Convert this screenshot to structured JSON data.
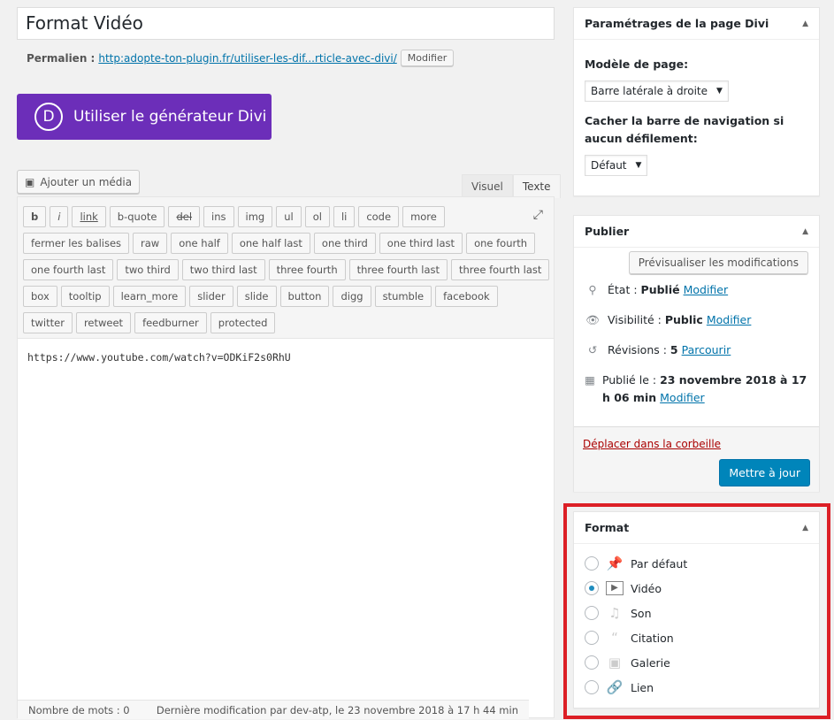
{
  "title": "Format Vidéo",
  "permalink": {
    "label": "Permalien :",
    "url": "http:adopte-ton-plugin.fr/utiliser-les-dif...rticle-avec-divi/",
    "edit": "Modifier"
  },
  "divi_button": {
    "icon": "D",
    "label": "Utiliser le générateur Divi",
    "color": "#6c2eb9"
  },
  "media_button": "Ajouter un média",
  "tabs": [
    "Visuel",
    "Texte"
  ],
  "quicktags": [
    [
      "b",
      "i",
      "link",
      "b-quote",
      "del",
      "ins",
      "img",
      "ul",
      "ol",
      "li",
      "code",
      "more"
    ],
    [
      "fermer les balises",
      "raw",
      "one half",
      "one half last",
      "one third",
      "one third last",
      "one fourth"
    ],
    [
      "one fourth last",
      "two third",
      "two third last",
      "three fourth",
      "three fourth last",
      "three fourth last"
    ],
    [
      "box",
      "tooltip",
      "learn_more",
      "slider",
      "slide",
      "button",
      "digg",
      "stumble",
      "facebook"
    ],
    [
      "twitter",
      "retweet",
      "feedburner",
      "protected"
    ]
  ],
  "content": "https://www.youtube.com/watch?v=ODKiF2s0RhU",
  "status": {
    "word_count": "Nombre de mots : 0",
    "last_modified": "Dernière modification par dev-atp, le 23 novembre 2018 à 17 h 44 min"
  },
  "divi_settings": {
    "title": "Paramétrages de la page Divi",
    "template_label": "Modèle de page:",
    "template_value": "Barre latérale à droite",
    "nav_label": "Cacher la barre de navigation si aucun défilement:",
    "nav_value": "Défaut"
  },
  "publish": {
    "title": "Publier",
    "preview": "Prévisualiser les modifications",
    "state_label": "État :",
    "state_value": "Publié",
    "state_link": "Modifier",
    "visibility_label": "Visibilité :",
    "visibility_value": "Public",
    "visibility_link": "Modifier",
    "revisions_label": "Révisions :",
    "revisions_value": "5",
    "revisions_link": "Parcourir",
    "published_label": "Publié le :",
    "published_value": "23 novembre 2018 à 17 h 06 min",
    "published_link": "Modifier",
    "trash": "Déplacer dans la corbeille",
    "update": "Mettre à jour"
  },
  "format": {
    "title": "Format",
    "highlight_color": "#dc1f26",
    "selected": "Vidéo",
    "options": [
      {
        "label": "Par défaut",
        "icon": "pin-icon"
      },
      {
        "label": "Vidéo",
        "icon": "video-icon"
      },
      {
        "label": "Son",
        "icon": "music-icon"
      },
      {
        "label": "Citation",
        "icon": "quote-icon"
      },
      {
        "label": "Galerie",
        "icon": "gallery-icon"
      },
      {
        "label": "Lien",
        "icon": "link-icon"
      }
    ]
  }
}
